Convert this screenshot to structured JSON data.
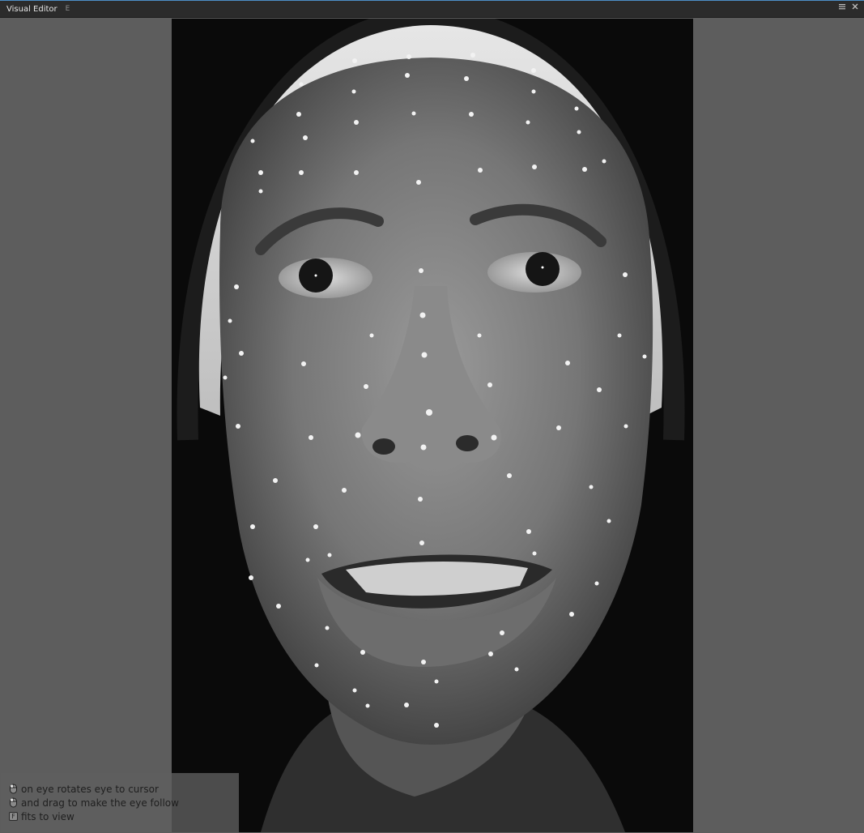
{
  "window": {
    "title": "Visual Editor",
    "shortcut": "E",
    "menu_icon": "hamburger-menu-icon",
    "close_icon": "close-icon"
  },
  "viewport": {
    "image_description_icon": "face-reference-photo",
    "background_color": "#5d5d5d"
  },
  "help": {
    "lines": [
      {
        "icon": "mouse-left-click-icon",
        "text": "on eye rotates eye to cursor"
      },
      {
        "icon": "mouse-left-drag-icon",
        "text": "and drag to make the eye follow"
      },
      {
        "icon": "key-f-icon",
        "key": "F",
        "text": "fits to view"
      }
    ]
  },
  "colors": {
    "titlebar": "#2b2b2b",
    "accent": "#4d8fc8",
    "panel": "#5d5d5d"
  }
}
